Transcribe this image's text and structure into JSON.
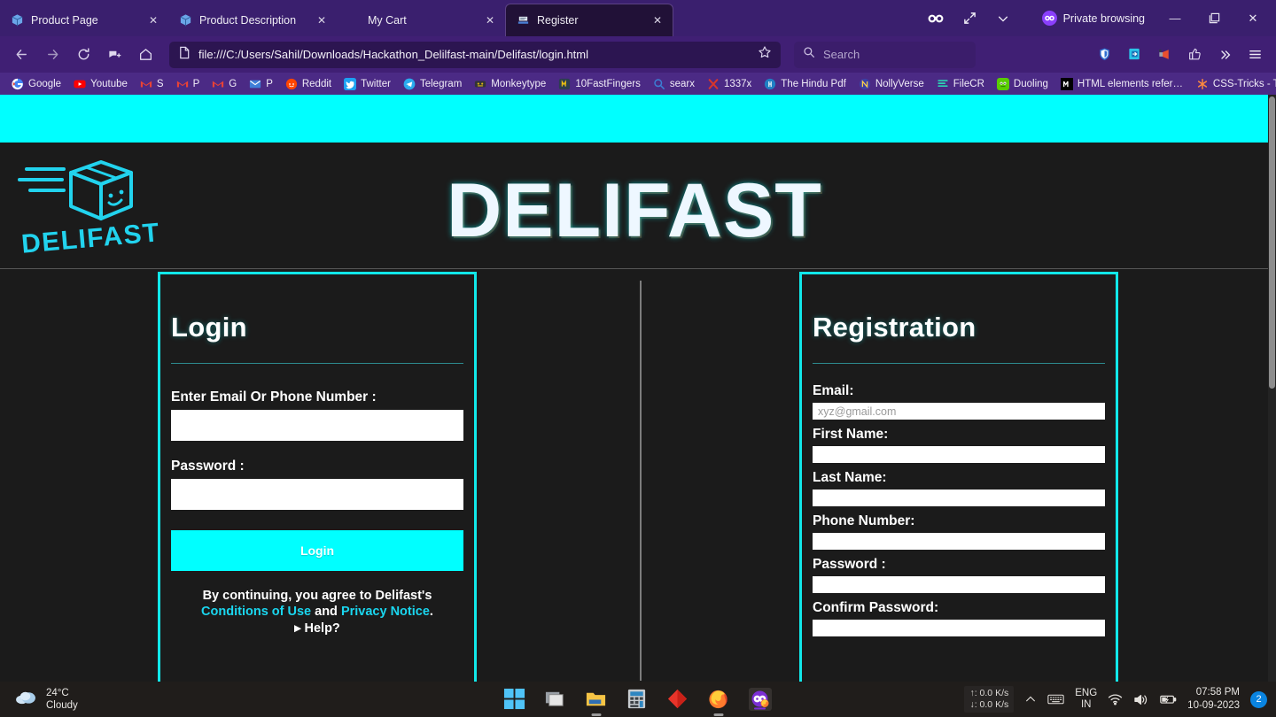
{
  "browser": {
    "tabs": [
      {
        "title": "Product Page",
        "favicon": "package-icon",
        "active": false
      },
      {
        "title": "Product Description",
        "favicon": "package-icon",
        "active": false
      },
      {
        "title": "My Cart",
        "favicon": "blank-icon",
        "active": false
      },
      {
        "title": "Register",
        "favicon": "form-icon",
        "active": true
      }
    ],
    "tab_close_label": "✕",
    "tab_extra_icons": [
      "infinity-icon",
      "expand-icon",
      "chevron-down-icon"
    ],
    "private_browsing_label": "Private browsing",
    "window_controls": {
      "minimize": "—",
      "maximize": "❐",
      "close": "✕"
    },
    "nav": {
      "back": "back-arrow-icon",
      "forward": "forward-arrow-icon",
      "reload": "reload-icon",
      "container": "container-tab-icon",
      "home": "home-icon"
    },
    "url": "file:///C:/Users/Sahil/Downloads/Hackathon_Delilfast-main/Delifast/login.html",
    "url_page_icon": "page-icon",
    "bookmark_star": "star-icon",
    "search_placeholder": "Search",
    "search_icon": "search-icon",
    "toolbar_right_icons": [
      "shield-icon",
      "save-to-pocket-icon",
      "megaphone-icon",
      "thumbs-up-icon",
      "overflow-chevrons-icon",
      "hamburger-menu-icon"
    ],
    "bookmarks": [
      {
        "label": "Google",
        "icon": "google-icon"
      },
      {
        "label": "Youtube",
        "icon": "youtube-icon"
      },
      {
        "label": "S",
        "icon": "gmail-icon"
      },
      {
        "label": "P",
        "icon": "gmail-icon"
      },
      {
        "label": "G",
        "icon": "gmail-icon"
      },
      {
        "label": "P",
        "icon": "mail-icon"
      },
      {
        "label": "Reddit",
        "icon": "reddit-icon"
      },
      {
        "label": "Twitter",
        "icon": "twitter-icon"
      },
      {
        "label": "Telegram",
        "icon": "telegram-icon"
      },
      {
        "label": "Monkeytype",
        "icon": "monkeytype-icon"
      },
      {
        "label": "10FastFingers",
        "icon": "tenfastfingers-icon"
      },
      {
        "label": "searx",
        "icon": "searx-icon"
      },
      {
        "label": "1337x",
        "icon": "1337x-icon"
      },
      {
        "label": "The Hindu Pdf",
        "icon": "epaper-icon"
      },
      {
        "label": "NollyVerse",
        "icon": "nollyverse-icon"
      },
      {
        "label": "FileCR",
        "icon": "filecr-icon"
      },
      {
        "label": "Duoling",
        "icon": "duolingo-icon"
      },
      {
        "label": "HTML elements refere...",
        "icon": "mdn-icon"
      },
      {
        "label": "CSS-Tricks - Tips, Trick...",
        "icon": "css-tricks-icon"
      }
    ],
    "bookmarks_overflow": "»"
  },
  "site": {
    "brand_title": "DELIFAST",
    "logo_text": "DELIFAST",
    "accent_cyan": "#00ffff",
    "accent_border": "#11e8ea",
    "background": "#1b1b1b"
  },
  "login": {
    "heading": "Login",
    "email_label": "Enter Email Or Phone Number :",
    "email_value": "",
    "email_placeholder": "",
    "password_label": "Password :",
    "password_value": "",
    "password_placeholder": "",
    "submit_label": "Login",
    "terms_prefix": "By continuing, you agree to Delifast's ",
    "terms_link1": "Conditions of Use",
    "terms_mid": " and ",
    "terms_link2": "Privacy Notice",
    "terms_suffix": ".",
    "help_label": "▸ Help?"
  },
  "registration": {
    "heading": "Registration",
    "fields": [
      {
        "label": "Email:",
        "value": "",
        "placeholder": "xyz@gmail.com"
      },
      {
        "label": "First Name:",
        "value": "",
        "placeholder": ""
      },
      {
        "label": "Last Name:",
        "value": "",
        "placeholder": ""
      },
      {
        "label": "Phone Number:",
        "value": "",
        "placeholder": ""
      },
      {
        "label": "Password :",
        "value": "",
        "placeholder": ""
      },
      {
        "label": "Confirm Password:",
        "value": "",
        "placeholder": ""
      }
    ]
  },
  "taskbar": {
    "weather_temp": "24°C",
    "weather_desc": "Cloudy",
    "weather_icon": "cloud-icon",
    "apps": [
      {
        "name": "start-button"
      },
      {
        "name": "task-view-button"
      },
      {
        "name": "file-explorer"
      },
      {
        "name": "calculator"
      },
      {
        "name": "red-diamond-app"
      },
      {
        "name": "firefox"
      },
      {
        "name": "firefox-private"
      }
    ],
    "net_up": "↑: 0.0 K/s",
    "net_down": "↓: 0.0 K/s",
    "tray_chevron": "chevron-up-icon",
    "tray_keyboard": "keyboard-icon",
    "language": "ENG",
    "region": "IN",
    "wifi_icon": "wifi-icon",
    "volume_icon": "volume-icon",
    "battery_icon": "battery-icon",
    "time": "07:58 PM",
    "date": "10-09-2023",
    "notification_count": "2"
  }
}
